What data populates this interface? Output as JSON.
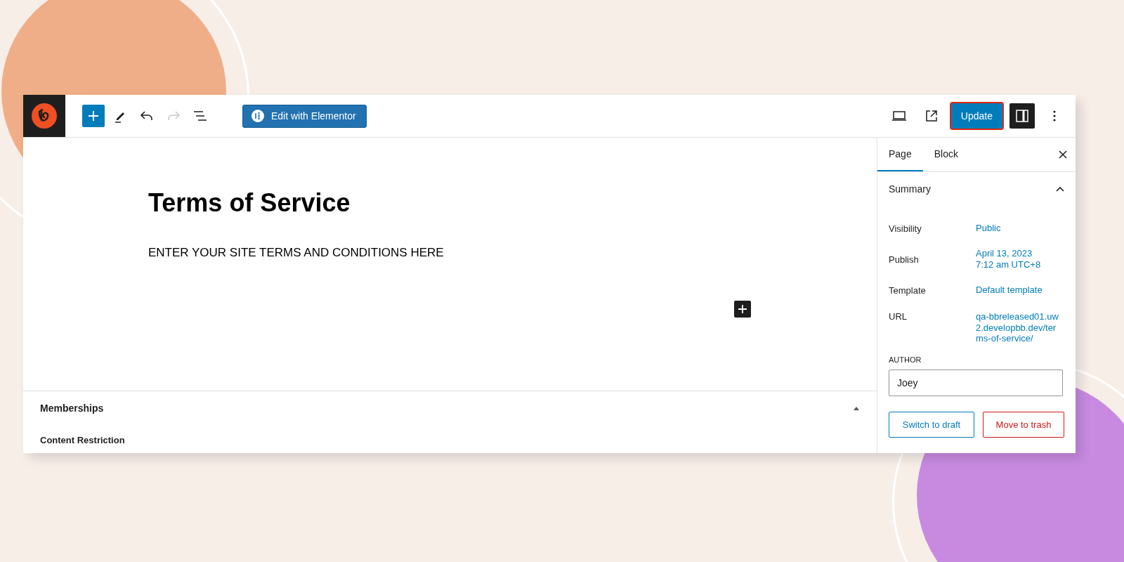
{
  "toolbar": {
    "tools": [
      {
        "kind": "add",
        "disabled": false
      },
      {
        "kind": "pen",
        "disabled": false
      },
      {
        "kind": "undo",
        "disabled": false
      },
      {
        "kind": "redo",
        "disabled": true
      },
      {
        "kind": "list",
        "disabled": false
      }
    ],
    "elementor_button": "Edit with Elementor",
    "update_button": {
      "label": "Update",
      "highlighted": true
    },
    "settings_toggle": {
      "on": true
    }
  },
  "document": {
    "title": "Terms of Service",
    "paragraph": "ENTER YOUR SITE TERMS AND CONDITIONS HERE"
  },
  "meta_panel": {
    "title": "Memberships",
    "expanded": true,
    "section": "Content Restriction"
  },
  "sidebar": {
    "tabs": [
      {
        "label": "Page",
        "selected": true
      },
      {
        "label": "Block",
        "selected": false
      }
    ],
    "summary": {
      "title": "Summary",
      "expanded": true,
      "rows": [
        {
          "label": "Visibility",
          "value": "Public"
        },
        {
          "label": "Publish",
          "value": "April 13, 2023\n7:12 am UTC+8"
        },
        {
          "label": "Template",
          "value": "Default template"
        },
        {
          "label": "URL",
          "value": "qa-bbreleased01.uw2.developbb.dev/terms-of-service/"
        }
      ]
    },
    "author": {
      "label": "AUTHOR",
      "value": "Joey"
    },
    "buttons": [
      {
        "kind": "secondary",
        "label": "Switch to draft"
      },
      {
        "kind": "danger",
        "label": "Move to trash"
      }
    ]
  }
}
